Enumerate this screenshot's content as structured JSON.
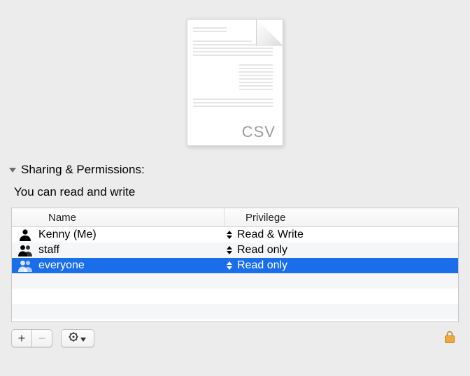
{
  "file_preview": {
    "extension": "CSV"
  },
  "section": {
    "title": "Sharing & Permissions:",
    "summary": "You can read and write"
  },
  "columns": {
    "name": "Name",
    "privilege": "Privilege"
  },
  "rows": [
    {
      "icon": "single",
      "name": "Kenny (Me)",
      "privilege": "Read & Write",
      "selected": false
    },
    {
      "icon": "double",
      "name": "staff",
      "privilege": "Read only",
      "selected": false
    },
    {
      "icon": "double",
      "name": "everyone",
      "privilege": "Read only",
      "selected": true
    }
  ],
  "toolbar": {
    "add": "+",
    "remove": "−",
    "remove_enabled": false
  }
}
